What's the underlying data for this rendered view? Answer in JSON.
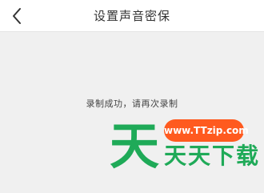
{
  "navbar": {
    "title": "设置声音密保",
    "back_icon": "chevron-left-icon"
  },
  "main": {
    "status_message": "录制成功，请再次录制"
  },
  "watermark": {
    "big_glyph": "天",
    "badge_text": "www.TTzip.com",
    "brand_text": "天天下载",
    "green": "#1faa58",
    "orange": "#ff5a1f"
  }
}
